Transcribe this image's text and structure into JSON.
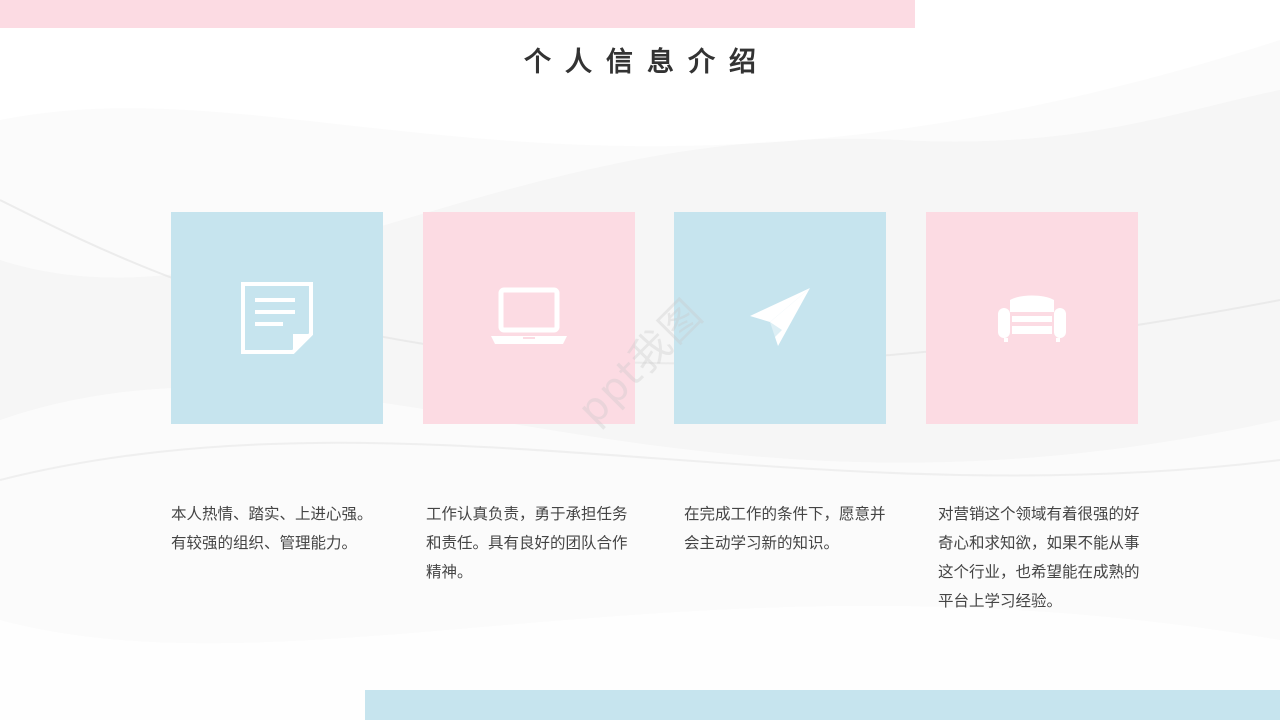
{
  "title": "个人信息介绍",
  "cards": [
    {
      "icon": "document-icon",
      "color": "#c6e4ee",
      "text": "本人热情、踏实、上进心强。有较强的组织、管理能力。"
    },
    {
      "icon": "laptop-icon",
      "color": "#fcdbe3",
      "text": "工作认真负责，勇于承担任务和责任。具有良好的团队合作精神。"
    },
    {
      "icon": "paper-plane-icon",
      "color": "#c6e4ee",
      "text": "在完成工作的条件下，愿意并会主动学习新的知识。"
    },
    {
      "icon": "sofa-icon",
      "color": "#fcdbe3",
      "text": "对营销这个领域有着很强的好奇心和求知欲，如果不能从事这个行业，也希望能在成熟的平台上学习经验。"
    }
  ],
  "colors": {
    "blue": "#c6e4ee",
    "pink": "#fcdbe3",
    "title": "#333333",
    "text": "#444444"
  },
  "watermark": "ppt我图"
}
